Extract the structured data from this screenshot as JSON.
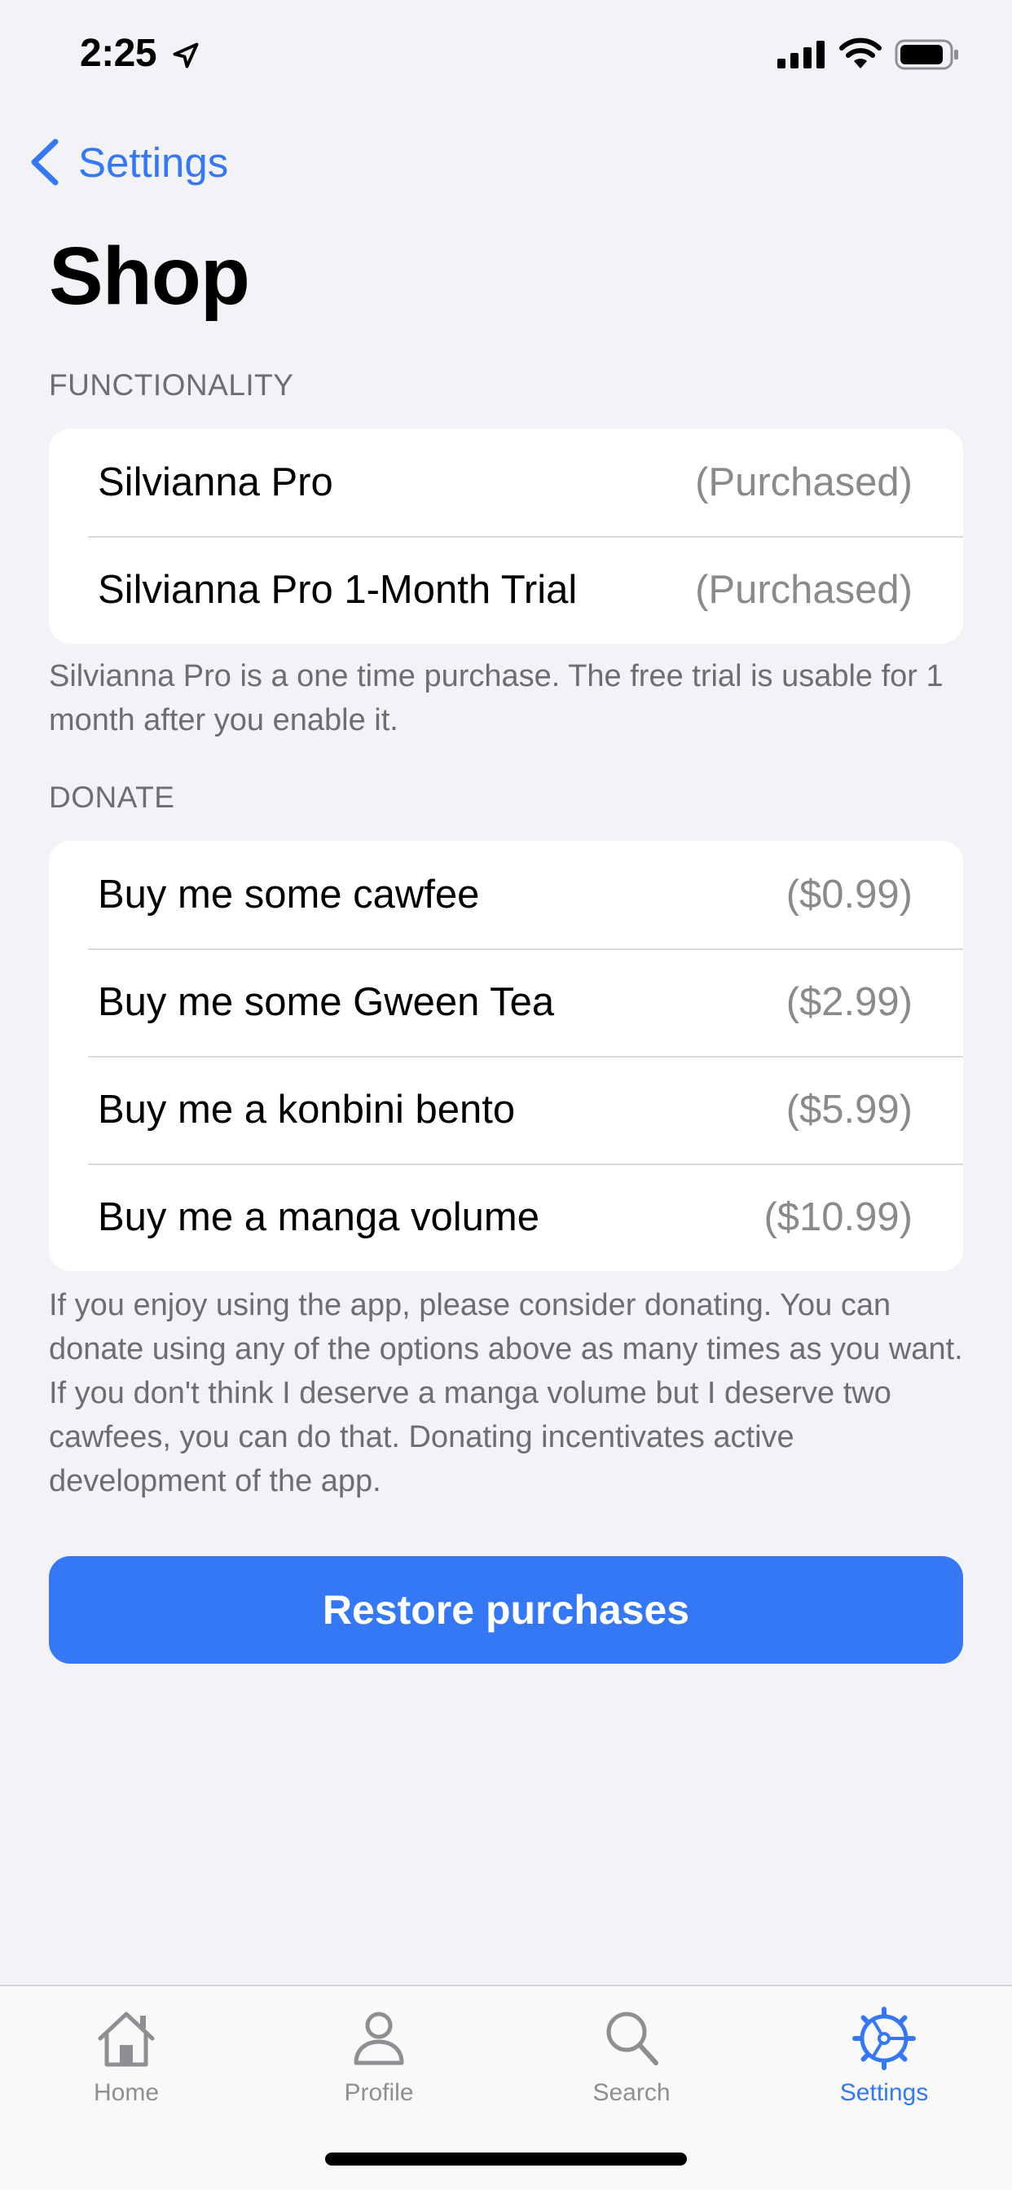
{
  "status": {
    "time": "2:25"
  },
  "nav": {
    "back_label": "Settings"
  },
  "page": {
    "title": "Shop"
  },
  "sections": {
    "functionality": {
      "header": "FUNCTIONALITY",
      "rows": [
        {
          "label": "Silvianna Pro",
          "value": "(Purchased)"
        },
        {
          "label": "Silvianna Pro 1-Month Trial",
          "value": "(Purchased)"
        }
      ],
      "footer": "Silvianna Pro is a one time purchase. The free trial is usable for 1 month after you enable it."
    },
    "donate": {
      "header": "DONATE",
      "rows": [
        {
          "label": "Buy me some cawfee",
          "value": "($0.99)"
        },
        {
          "label": "Buy me some Gween Tea",
          "value": "($2.99)"
        },
        {
          "label": "Buy me a konbini bento",
          "value": "($5.99)"
        },
        {
          "label": "Buy me a manga volume",
          "value": "($10.99)"
        }
      ],
      "footer": "If you enjoy using the app, please consider donating. You can donate using any of the options above as many times as you want. If you don't think I deserve a manga volume but I deserve two cawfees, you can do that. Donating incentivates active development of the app."
    }
  },
  "restore_button": {
    "label": "Restore purchases"
  },
  "tab_bar": {
    "tabs": [
      {
        "label": "Home",
        "icon": "house-icon",
        "active": false
      },
      {
        "label": "Profile",
        "icon": "person-icon",
        "active": false
      },
      {
        "label": "Search",
        "icon": "magnifier-icon",
        "active": false
      },
      {
        "label": "Settings",
        "icon": "gear-icon",
        "active": true
      }
    ]
  },
  "colors": {
    "accent": "#3478f6",
    "background": "#f2f2f7",
    "secondary_text": "#6d6d72",
    "value_text": "#8a8a8e",
    "inactive_tab": "#8e8e93"
  }
}
